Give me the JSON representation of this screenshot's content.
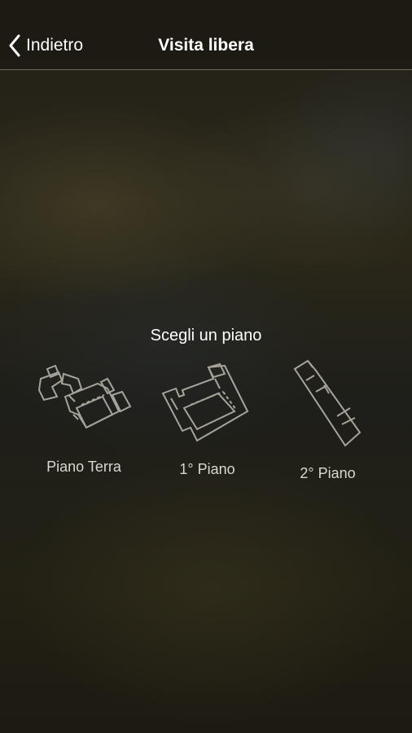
{
  "navbar": {
    "back_label": "Indietro",
    "title": "Visita libera",
    "back_icon": "chevron-left-icon"
  },
  "main": {
    "prompt": "Scegli un piano",
    "floors": [
      {
        "label": "Piano Terra",
        "icon": "floor-plan-icon"
      },
      {
        "label": "1° Piano",
        "icon": "floor-plan-icon"
      },
      {
        "label": "2° Piano",
        "icon": "floor-plan-icon"
      }
    ]
  },
  "colors": {
    "text": "#ffffff",
    "label": "#d9d7d0",
    "plan_stroke": "#a6a39a"
  }
}
